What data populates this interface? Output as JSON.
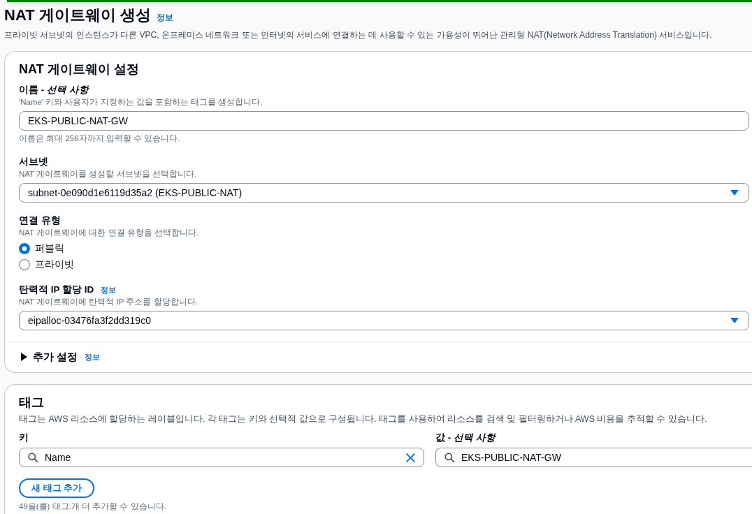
{
  "header": {
    "title": "NAT 게이트웨이 생성",
    "info_link": "정보",
    "description": "프라이빗 서브넷의 인스턴스가 다른 VPC, 온프레미스 네트워크 또는 인터넷의 서비스에 연결하는 데 사용할 수 있는 가용성이 뛰어난 관리형 NAT(Network Address Translation) 서비스입니다."
  },
  "settings_panel": {
    "title": "NAT 게이트웨이 설정",
    "fields": [
      {
        "kind": "text",
        "label": "이름 - *선택 사항*",
        "description": "'Name' 키와 사용자가 지정하는 값을 포함하는 태그를 생성합니다.",
        "value": "EKS-PUBLIC-NAT-GW",
        "hint": "이름은 최대 256자까지 입력할 수 있습니다."
      },
      {
        "kind": "select",
        "label": "서브넷",
        "description": "NAT 게이트웨이를 생성할 서브넷을 선택합니다.",
        "value": "subnet-0e090d1e6119d35a2 (EKS-PUBLIC-NAT)"
      },
      {
        "kind": "radio",
        "label": "연결 유형",
        "description": "NAT 게이트웨이에 대한 연결 유형을 선택합니다.",
        "options": [
          {
            "label": "퍼블릭",
            "selected": true
          },
          {
            "label": "프라이빗",
            "selected": false
          }
        ]
      },
      {
        "kind": "select",
        "label": "탄력적 IP 할당 ID",
        "info_link": "정보",
        "description": "NAT 게이트웨이에 탄력적 IP 주소를 할당합니다.",
        "value": "eipalloc-03476fa3f2dd319c0"
      }
    ],
    "additional_settings": {
      "label": "추가 설정",
      "info_link": "정보",
      "expanded": false
    }
  },
  "tags_panel": {
    "title": "태그",
    "description": "태그는 AWS 리소스에 할당하는 레이블입니다. 각 태그는 키와 선택적 값으로 구성됩니다. 태그를 사용하여 리소스를 검색 및 필터링하거나 AWS 비용을 추적할 수 있습니다.",
    "key_label": "키",
    "value_label": "값 - *선택 사항*",
    "tags": [
      {
        "key": "Name",
        "value": "EKS-PUBLIC-NAT-GW"
      }
    ],
    "add_button": "새 태그 추가",
    "hint": "49을(를) 태그.개 더 추가할 수 있습니다."
  }
}
